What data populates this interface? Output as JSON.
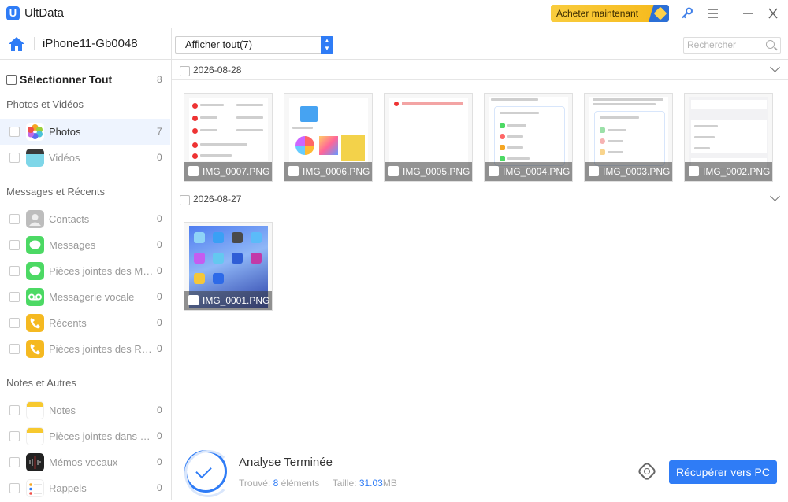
{
  "app": {
    "title": "UltData",
    "buy_label": "Acheter maintenant"
  },
  "toolbar": {
    "device_name": "iPhone11-Gb0048",
    "filter_value": "Afficher tout(7)",
    "search_placeholder": "Rechercher"
  },
  "sidebar": {
    "select_all_label": "Sélectionner Tout",
    "select_all_count": "8",
    "categories": [
      {
        "title": "Photos et Vidéos",
        "items": [
          {
            "label": "Photos",
            "count": "7",
            "icon": "photos-icon",
            "active": true
          },
          {
            "label": "Vidéos",
            "count": "0",
            "icon": "videos-icon"
          }
        ]
      },
      {
        "title": "Messages et Récents",
        "items": [
          {
            "label": "Contacts",
            "count": "0",
            "icon": "contacts-icon"
          },
          {
            "label": "Messages",
            "count": "0",
            "icon": "messages-icon"
          },
          {
            "label": "Pièces jointes des Messages",
            "count": "0",
            "icon": "message-attachments-icon"
          },
          {
            "label": "Messagerie vocale",
            "count": "0",
            "icon": "voicemail-icon"
          },
          {
            "label": "Récents",
            "count": "0",
            "icon": "recent-calls-icon"
          },
          {
            "label": "Pièces jointes des Récents",
            "count": "0",
            "icon": "recent-attachments-icon"
          }
        ]
      },
      {
        "title": "Notes et Autres",
        "items": [
          {
            "label": "Notes",
            "count": "0",
            "icon": "notes-icon"
          },
          {
            "label": "Pièces jointes dans Notes",
            "count": "0",
            "icon": "notes-attachments-icon"
          },
          {
            "label": "Mémos vocaux",
            "count": "0",
            "icon": "voice-memos-icon"
          },
          {
            "label": "Rappels",
            "count": "0",
            "icon": "reminders-icon"
          }
        ]
      }
    ]
  },
  "groups": [
    {
      "date": "2026-08-28",
      "files": [
        "IMG_0007.PNG",
        "IMG_0006.PNG",
        "IMG_0005.PNG",
        "IMG_0004.PNG",
        "IMG_0003.PNG",
        "IMG_0002.PNG"
      ]
    },
    {
      "date": "2026-08-27",
      "files": [
        "IMG_0001.PNG"
      ]
    }
  ],
  "status": {
    "title": "Analyse Terminée",
    "found_label": "Trouvé:",
    "found_value": "8",
    "found_unit": "éléments",
    "size_label": "Taille:",
    "size_value": "31.03",
    "size_unit": "MB",
    "recover_label": "Récupérer vers PC"
  },
  "colors": {
    "accent": "#2f7cf6",
    "buy": "#f6b91b"
  }
}
